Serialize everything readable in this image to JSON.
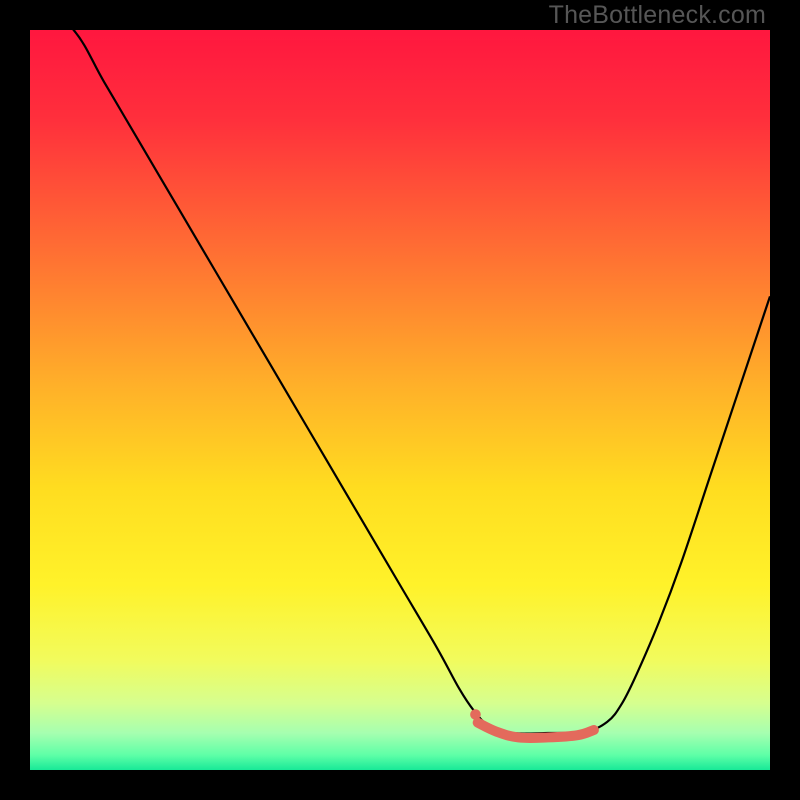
{
  "watermark": "TheBottleneck.com",
  "chart_data": {
    "type": "line",
    "title": "",
    "xlabel": "",
    "ylabel": "",
    "xlim": [
      0,
      100
    ],
    "ylim": [
      0,
      100
    ],
    "note": "Axes are percent-of-plot; curve represents a bottleneck metric where higher on screen (lower y) = worse, valley near x≈63-75 = optimal region. An accent marker highlights the valley.",
    "series": [
      {
        "name": "bottleneck-curve",
        "color": "#000000",
        "width": 2.2,
        "x": [
          0,
          5.9,
          10,
          15,
          20,
          25,
          30,
          35,
          40,
          45,
          50,
          55,
          58,
          60,
          62,
          65,
          70,
          75,
          78,
          80,
          82,
          85,
          88,
          92,
          96,
          100
        ],
        "y": [
          105,
          100,
          93,
          84.5,
          76,
          67.5,
          59,
          50.5,
          42,
          33.5,
          25,
          16.5,
          11,
          8,
          6,
          5,
          5,
          5.2,
          6.5,
          9,
          13,
          20,
          28,
          40,
          52,
          64
        ]
      },
      {
        "name": "valley-highlight",
        "color": "#e36a5c",
        "width": 10,
        "linecap": "round",
        "x": [
          60.5,
          63,
          66,
          70,
          74,
          76.2
        ],
        "y": [
          6.4,
          5.2,
          4.4,
          4.4,
          4.7,
          5.4
        ]
      }
    ],
    "markers": [
      {
        "name": "valley-start-dot",
        "x": 60.2,
        "y": 7.5,
        "r": 5.3,
        "color": "#e36a5c"
      }
    ]
  }
}
